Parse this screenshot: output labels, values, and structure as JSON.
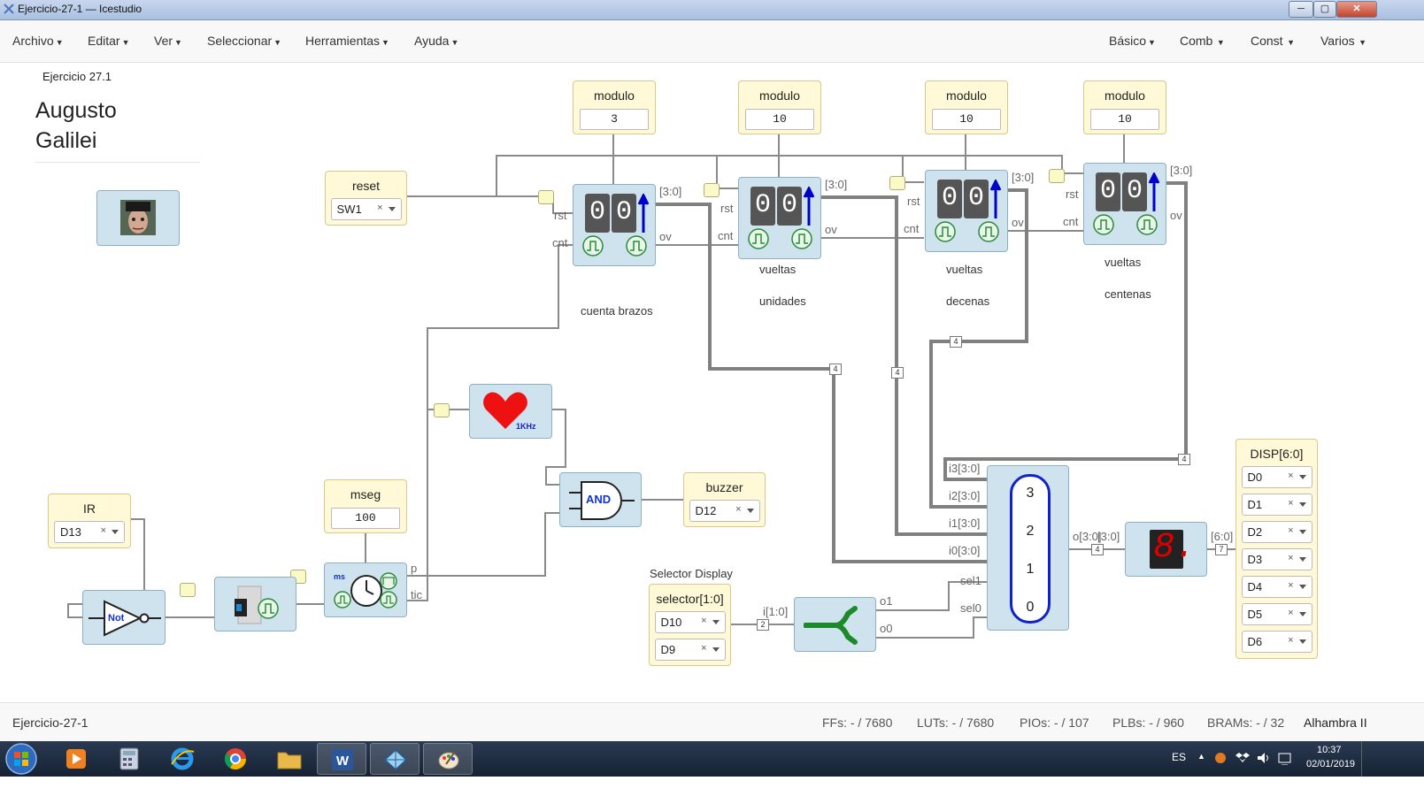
{
  "window": {
    "title": "Ejercicio-27-1 — Icestudio",
    "min": "─",
    "max": "▢",
    "close": "✕"
  },
  "menu": {
    "left": [
      "Archivo",
      "Editar",
      "Ver",
      "Seleccionar",
      "Herramientas",
      "Ayuda"
    ],
    "right": [
      "Básico",
      "Comb",
      "Const",
      "Varios"
    ]
  },
  "info": {
    "title": "Ejercicio 27.1",
    "author_line1": "Augusto",
    "author_line2": "Galilei"
  },
  "inputs": {
    "reset": {
      "title": "reset",
      "pin": "SW1"
    },
    "ir": {
      "title": "IR",
      "pin": "D13"
    },
    "selector": {
      "title": "selector[1:0]",
      "pin1": "D10",
      "pin2": "D9",
      "caption": "Selector Display"
    }
  },
  "outputs": {
    "buzzer": {
      "title": "buzzer",
      "pin": "D12"
    },
    "disp": {
      "title": "DISP[6:0]",
      "pins": [
        "D0",
        "D1",
        "D2",
        "D3",
        "D4",
        "D5",
        "D6"
      ]
    }
  },
  "constants": [
    {
      "title": "modulo",
      "value": "3"
    },
    {
      "title": "modulo",
      "value": "10"
    },
    {
      "title": "modulo",
      "value": "10"
    },
    {
      "title": "modulo",
      "value": "10"
    },
    {
      "title": "mseg",
      "value": "100"
    }
  ],
  "counters": [
    {
      "digits": [
        "0",
        "0"
      ],
      "caption1": "cuenta brazos",
      "caption2": ""
    },
    {
      "digits": [
        "0",
        "0"
      ],
      "caption1": "vueltas",
      "caption2": "unidades"
    },
    {
      "digits": [
        "0",
        "0"
      ],
      "caption1": "vueltas",
      "caption2": "decenas"
    },
    {
      "digits": [
        "0",
        "0"
      ],
      "caption1": "vueltas",
      "caption2": "centenas"
    }
  ],
  "ports": {
    "rst": "rst",
    "cnt": "cnt",
    "ov": "ov",
    "bus30": "[3:0]",
    "p": "p",
    "tic": "tic",
    "ms": "ms",
    "i3": "i3[3:0]",
    "i2": "i2[3:0]",
    "i1": "i1[3:0]",
    "i0": "i0[3:0]",
    "sel1": "sel1",
    "sel0": "sel0",
    "o30": "o[3:0]",
    "b30": "[3:0]",
    "b60": "[6:0]",
    "i10": "i[1:0]",
    "o1": "o1",
    "o0": "o0"
  },
  "gates": {
    "and": "AND",
    "not": "Not",
    "khz": "1KHz"
  },
  "mux_digits": [
    "3",
    "2",
    "1",
    "0"
  ],
  "seg_digit": "8.",
  "wire_sizes": {
    "w4": "4",
    "w2": "2",
    "w7": "7"
  },
  "status": {
    "file": "Ejercicio-27-1",
    "ffs": "FFs:  - / 7680",
    "luts": "LUTs:  - / 7680",
    "pios": "PIOs:  - / 107",
    "plbs": "PLBs:  - / 960",
    "brams": "BRAMs:  - / 32",
    "board": "Alhambra II"
  },
  "taskbar": {
    "lang": "ES",
    "time": "10:37",
    "date": "02/01/2019"
  },
  "colors": {
    "wire": "#777777",
    "block": "#cfe3ee",
    "param": "#fff9d8",
    "digit": "#555555",
    "arrow": "#0000cc",
    "led": "#dd0000",
    "heart": "#ee1111"
  }
}
